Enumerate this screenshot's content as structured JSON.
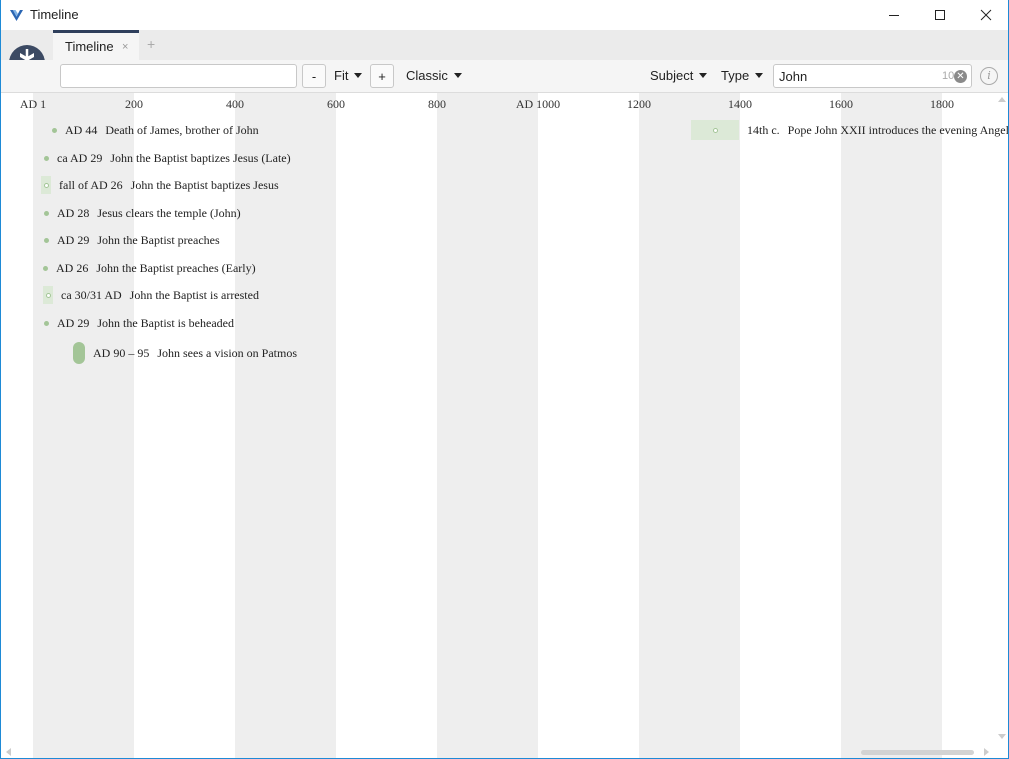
{
  "window": {
    "title": "Timeline",
    "app_icon": "logos-v-icon",
    "controls": [
      "minimize-icon",
      "maximize-icon",
      "close-icon"
    ]
  },
  "tabs": [
    {
      "label": "Timeline",
      "active": true,
      "close_glyph": "×"
    }
  ],
  "add_tab_glyph": "+",
  "toolbar": {
    "range_input_value": "",
    "zoom_out_label": "-",
    "fit_label": "Fit",
    "zoom_in_label": "+",
    "style_label": "Classic",
    "subject_label": "Subject",
    "type_label": "Type",
    "search_value": "John",
    "search_count": "10",
    "info_glyph": "i"
  },
  "ruler_ticks": [
    "AD 1",
    "200",
    "400",
    "600",
    "800",
    "AD 1000",
    "1200",
    "1400",
    "1600",
    "1800"
  ],
  "events": [
    {
      "date": "AD 44",
      "title": "Death of James, brother of John"
    },
    {
      "date": "ca AD 29",
      "title": "John the Baptist baptizes Jesus (Late)"
    },
    {
      "date": "fall of AD 26",
      "title": "John the Baptist baptizes Jesus"
    },
    {
      "date": "AD 28",
      "title": "Jesus clears the temple (John)"
    },
    {
      "date": "AD 29",
      "title": "John the Baptist preaches"
    },
    {
      "date": "AD 26",
      "title": "John the Baptist preaches (Early)"
    },
    {
      "date": "ca 30/31 AD",
      "title": "John the Baptist is arrested"
    },
    {
      "date": "AD 29",
      "title": "John the Baptist is beheaded"
    },
    {
      "date": "AD 90 – 95",
      "title": "John sees a vision on Patmos"
    },
    {
      "date": "14th c.",
      "title": "Pope John XXII introduces the evening Angelus"
    }
  ],
  "colors": {
    "accent": "#2f3f5c",
    "event_marker": "#a3c597",
    "event_span": "#dce9d7",
    "band": "#eeeeee"
  }
}
